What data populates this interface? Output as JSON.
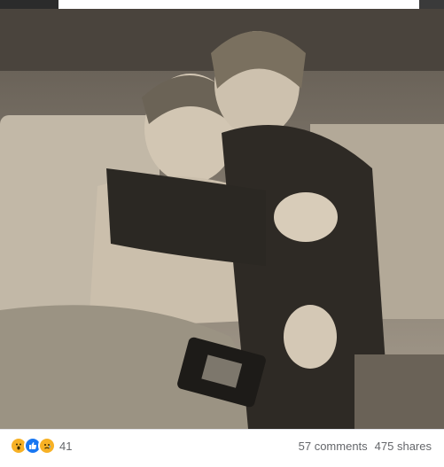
{
  "post": {
    "reactions": {
      "icons": [
        "wow-icon",
        "like-icon",
        "sad-icon"
      ],
      "count": "41"
    },
    "comments_label": "57 comments",
    "shares_label": "475 shares"
  },
  "colors": {
    "like_blue": "#1877f2",
    "reaction_yellow": "#f7b125",
    "meta_text": "#65676b",
    "photo_sepia": "#8a8175"
  }
}
